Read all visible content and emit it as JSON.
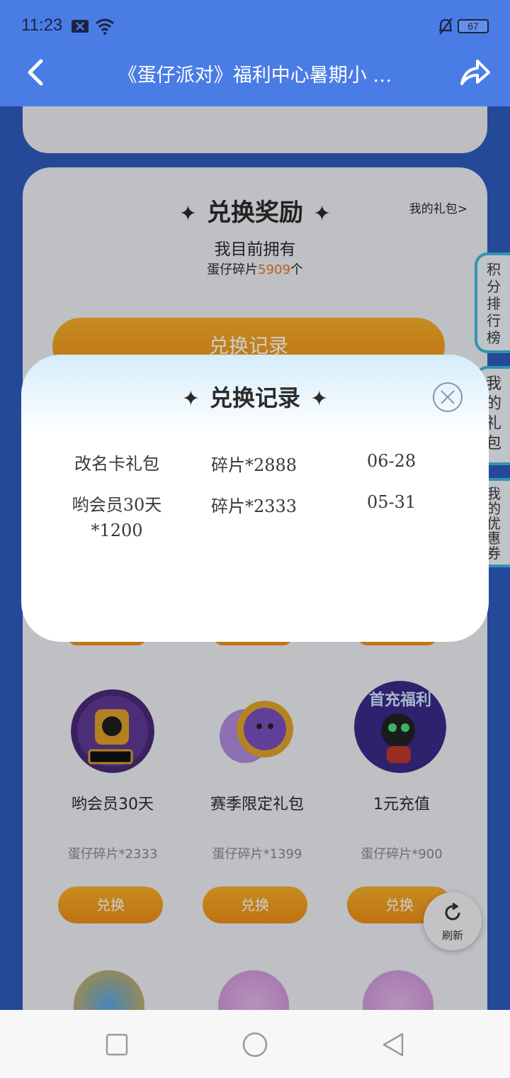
{
  "status_bar": {
    "time": "11:23",
    "battery": "67"
  },
  "header": {
    "title": "《蛋仔派对》福利中心暑期小 …"
  },
  "exchange": {
    "title": "兑换奖励",
    "my_gift_link": "我的礼包>",
    "own_label": "我目前拥有",
    "own_prefix": "蛋仔碎片",
    "own_count": "5909",
    "own_suffix": "个",
    "record_button": "兑换记录"
  },
  "side_tabs": [
    {
      "label": "积分排行榜"
    },
    {
      "label": "我的礼包"
    },
    {
      "label": "我的优惠券"
    }
  ],
  "items": [
    {
      "name": "哟会员30天",
      "cost": "蛋仔碎片*2333",
      "button": "兑换",
      "icon": "member-card-icon"
    },
    {
      "name": "赛季限定礼包",
      "cost": "蛋仔碎片*1399",
      "button": "兑换",
      "icon": "coin-icon"
    },
    {
      "name": "1元充值",
      "cost": "蛋仔碎片*900",
      "button": "兑换",
      "icon": "recharge-icon",
      "badge": "首充福利"
    }
  ],
  "refresh": {
    "label": "刷新"
  },
  "modal": {
    "title": "兑换记录",
    "records": [
      {
        "name": "改名卡礼包",
        "cost": "碎片*2888",
        "date": "06-28"
      },
      {
        "name": "哟会员30天*1200",
        "cost": "碎片*2333",
        "date": "05-31"
      }
    ]
  },
  "colors": {
    "header_bg": "#4a7ce6",
    "accent_orange": "#ef8f16",
    "count_highlight": "#e7772a",
    "side_tab_border": "#41b8d9"
  }
}
